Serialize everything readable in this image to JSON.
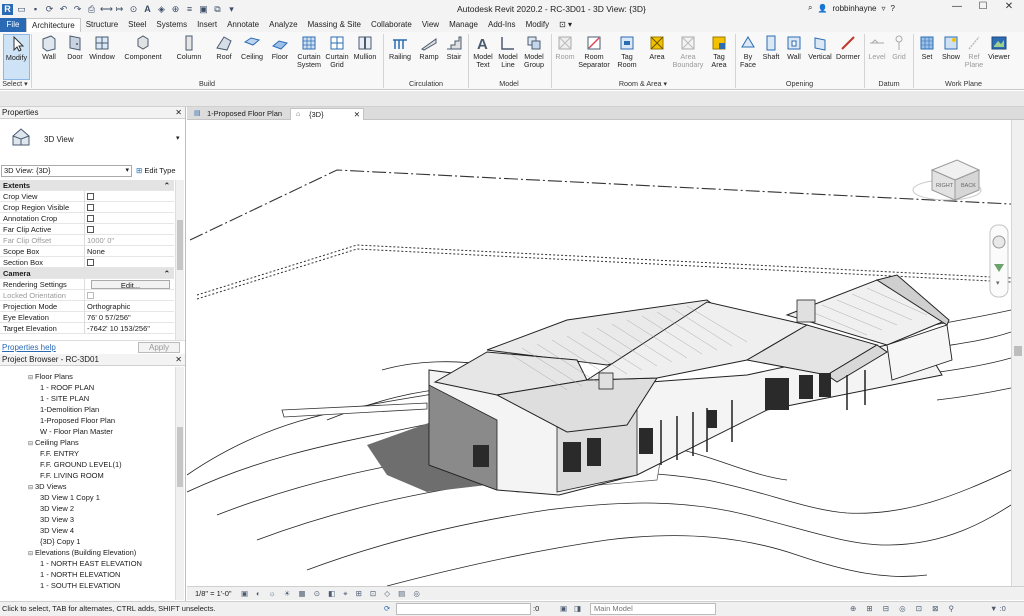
{
  "app": {
    "title": "Autodesk Revit 2020.2 - RC-3D01 - 3D View: {3D}",
    "user": "robbinhayne"
  },
  "ribbon_tabs": [
    "File",
    "Architecture",
    "Structure",
    "Steel",
    "Systems",
    "Insert",
    "Annotate",
    "Analyze",
    "Massing & Site",
    "Collaborate",
    "View",
    "Manage",
    "Add-Ins",
    "Modify"
  ],
  "active_tab": "Architecture",
  "ribbon": {
    "modify": "Modify",
    "select_label": "Select ▾",
    "build": {
      "label": "Build",
      "buttons": [
        "Wall",
        "Door",
        "Window",
        "Component",
        "Column",
        "Roof",
        "Ceiling",
        "Floor",
        "Curtain System",
        "Curtain Grid",
        "Mullion"
      ]
    },
    "circulation": {
      "label": "Circulation",
      "buttons": [
        "Railing",
        "Ramp",
        "Stair"
      ]
    },
    "model": {
      "label": "Model",
      "buttons": [
        "Model Text",
        "Model Line",
        "Model Group"
      ]
    },
    "room_area": {
      "label": "Room & Area ▾",
      "buttons": [
        "Room",
        "Room Separator",
        "Tag Room",
        "Area",
        "Area Boundary",
        "Tag Area"
      ]
    },
    "opening": {
      "label": "Opening",
      "buttons": [
        "By Face",
        "Shaft",
        "Wall",
        "Vertical",
        "Dormer"
      ]
    },
    "datum": {
      "label": "Datum",
      "buttons": [
        "Level",
        "Grid"
      ]
    },
    "work_plane": {
      "label": "Work Plane",
      "buttons": [
        "Set",
        "Show",
        "Ref Plane",
        "Viewer"
      ]
    }
  },
  "properties": {
    "title": "Properties",
    "type_name": "3D View",
    "selector": "3D View: {3D}",
    "edit_type": "Edit Type",
    "groups": [
      {
        "name": "Extents",
        "rows": [
          {
            "k": "Crop View",
            "v": ""
          },
          {
            "k": "Crop Region Visible",
            "v": ""
          },
          {
            "k": "Annotation Crop",
            "v": ""
          },
          {
            "k": "Far Clip Active",
            "v": ""
          },
          {
            "k": "Far Clip Offset",
            "v": "1000'  0\""
          },
          {
            "k": "Scope Box",
            "v": "None"
          },
          {
            "k": "Section Box",
            "v": ""
          }
        ]
      },
      {
        "name": "Camera",
        "rows": [
          {
            "k": "Rendering Settings",
            "v": "Edit..."
          },
          {
            "k": "Locked Orientation",
            "v": ""
          },
          {
            "k": "Projection Mode",
            "v": "Orthographic"
          },
          {
            "k": "Eye Elevation",
            "v": "76'  0 57/256\""
          },
          {
            "k": "Target Elevation",
            "v": "-7642'  10 153/256\""
          }
        ]
      }
    ],
    "help": "Properties help",
    "apply": "Apply"
  },
  "project_browser": {
    "title": "Project Browser - RC-3D01",
    "items": [
      {
        "level": 1,
        "label": "Floor Plans",
        "kind": "folder"
      },
      {
        "level": 2,
        "label": "1 - ROOF PLAN"
      },
      {
        "level": 2,
        "label": "1 - SITE PLAN"
      },
      {
        "level": 2,
        "label": "1-Demolition Plan"
      },
      {
        "level": 2,
        "label": "1-Proposed Floor Plan"
      },
      {
        "level": 2,
        "label": "W - Floor Plan Master"
      },
      {
        "level": 1,
        "label": "Ceiling Plans",
        "kind": "folder"
      },
      {
        "level": 2,
        "label": "F.F. ENTRY"
      },
      {
        "level": 2,
        "label": "F.F. GROUND LEVEL(1)"
      },
      {
        "level": 2,
        "label": "F.F. LIVING ROOM"
      },
      {
        "level": 1,
        "label": "3D Views",
        "kind": "folder"
      },
      {
        "level": 2,
        "label": "3D View 1 Copy 1"
      },
      {
        "level": 2,
        "label": "3D View 2"
      },
      {
        "level": 2,
        "label": "3D View 3"
      },
      {
        "level": 2,
        "label": "3D View 4"
      },
      {
        "level": 2,
        "label": "{3D} Copy 1"
      },
      {
        "level": 1,
        "label": "Elevations (Building Elevation)",
        "kind": "folder"
      },
      {
        "level": 2,
        "label": "1 - NORTH EAST ELEVATION"
      },
      {
        "level": 2,
        "label": "1 - NORTH ELEVATION"
      },
      {
        "level": 2,
        "label": "1 - SOUTH ELEVATION"
      }
    ]
  },
  "view_tabs": [
    "1-Proposed Floor Plan",
    "{3D}"
  ],
  "viewcube": {
    "face_right": "RIGHT",
    "face_back": "BACK"
  },
  "view_scale": "1/8\" = 1'-0\"",
  "status": {
    "hint": "Click to select, TAB for alternates, CTRL adds, SHIFT unselects.",
    "coord": ":0",
    "model": "Main Model"
  },
  "colors": {
    "file_tab": "#2a6ab5",
    "ribbon_icon": "#2b6cb3",
    "accent_yellow": "#f2c200"
  }
}
